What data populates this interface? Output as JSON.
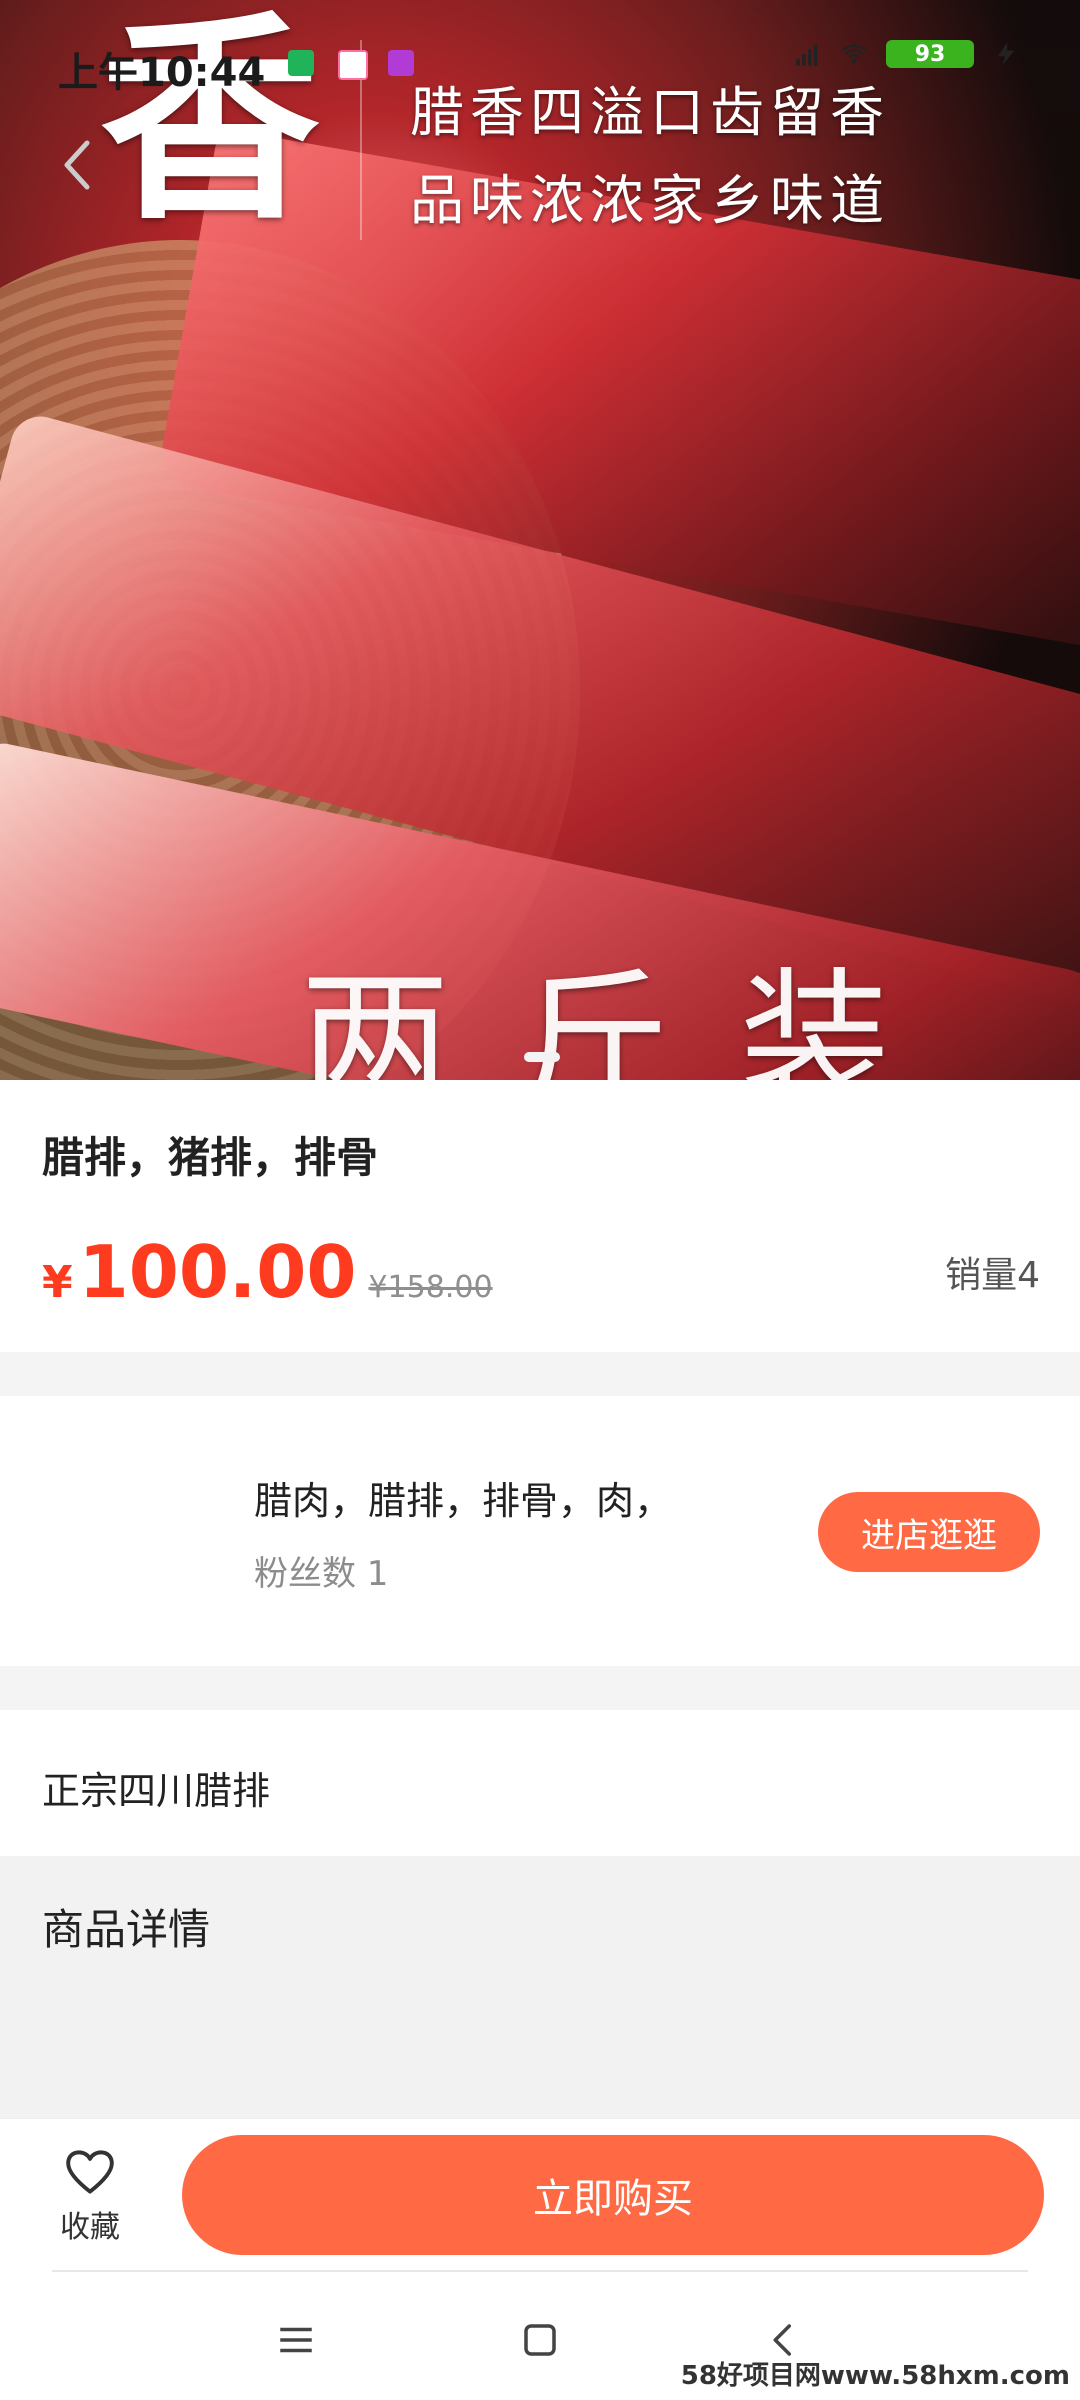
{
  "status_bar": {
    "time": "上午10:44",
    "battery": "93"
  },
  "hero": {
    "big_character": "香",
    "line1": "腊香四溢口齿留香",
    "line2": "品味浓浓家乡味道",
    "bottom_text": "两斤装"
  },
  "product": {
    "title": "腊排，猪排，排骨",
    "currency_symbol": "¥",
    "price": "100.00",
    "original_price": "¥158.00",
    "sales": "销量4"
  },
  "shop": {
    "name": "腊肉，腊排，排骨，肉，",
    "fans": "粉丝数 1",
    "visit_button": "进店逛逛"
  },
  "description": {
    "text": "正宗四川腊排"
  },
  "details": {
    "title": "商品详情"
  },
  "bottom_bar": {
    "favorite_label": "收藏",
    "buy_button": "立即购买"
  },
  "watermark": "58好项目网www.58hxm.com",
  "colors": {
    "accent": "#ff6a45",
    "price": "#ff3b1f",
    "battery": "#3bb31f"
  }
}
